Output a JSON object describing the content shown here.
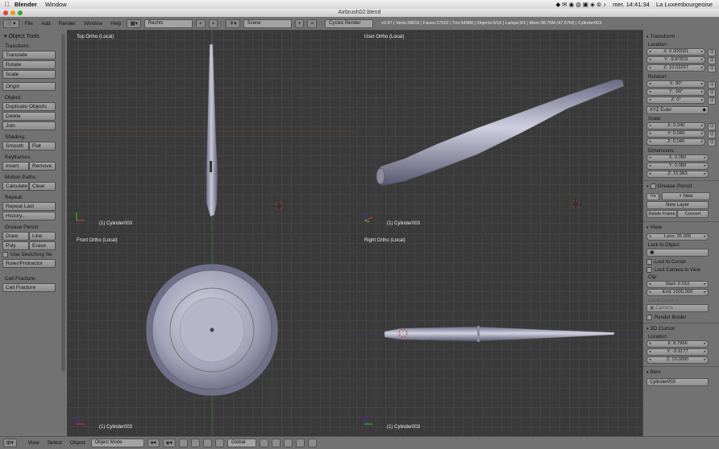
{
  "menubar": {
    "app": "Blender",
    "window_menu": "Window",
    "clock": "mer. 14:41:34",
    "user": "La Luxembourgeoise"
  },
  "titlebar": {
    "title": "Airbrush02.blend"
  },
  "infobar": {
    "menus": [
      "File",
      "Add",
      "Render",
      "Window",
      "Help"
    ],
    "layout": "Rechts",
    "scene": "Scene",
    "engine": "Cycles Render",
    "stats": "v2.67 | Verts:28616 | Faces:27522 | Tris:54988 | Objects:0/16 | Lamps:0/1 | Mem:38.70M (47.57M) | Cylinder003"
  },
  "toolshelf": {
    "title": "Object Tools",
    "transform_label": "Transform:",
    "translate": "Translate",
    "rotate": "Rotate",
    "scale": "Scale",
    "origin": "Origin",
    "object_label": "Object:",
    "duplicate": "Duplicate Objects",
    "delete": "Delete",
    "join": "Join",
    "shading_label": "Shading:",
    "smooth": "Smooth",
    "flat": "Flat",
    "keyframes_label": "Keyframes:",
    "insert": "Insert",
    "remove": "Remove",
    "motion_label": "Motion Paths:",
    "calculate": "Calculate",
    "clear": "Clear",
    "repeat_label": "Repeat:",
    "repeat_last": "Repeat Last",
    "history": "History...",
    "grease_label": "Grease Pencil:",
    "draw": "Draw",
    "line": "Line",
    "poly": "Poly",
    "erase": "Erase",
    "sketching": "Use Sketching Se",
    "ruler": "Ruler/Protractor",
    "cell_label": "Cell Fracture:",
    "cell_btn": "Cell Fracture"
  },
  "viewport": {
    "top_left": "Top Ortho (Local)",
    "top_right": "User Ortho (Local)",
    "bottom_left": "Front Ortho (Local)",
    "bottom_right": "Right Ortho (Local)",
    "object": "(1) Cylinder003"
  },
  "props": {
    "transform_title": "Transform",
    "location_label": "Location:",
    "loc_x": "X: 0.000001",
    "loc_y": "Y: -9.87815",
    "loc_z": "Z: 10.03257",
    "rotation_label": "Rotation:",
    "rot_x": "X: 90°",
    "rot_y": "Y: -90°",
    "rot_z": "Z: 0°",
    "euler": "XYZ Euler",
    "scale_label": "Scale:",
    "scale_x": "X: 0.040",
    "scale_y": "Y: 0.040",
    "scale_z": "Z: 0.040",
    "dim_label": "Dimensions:",
    "dim_x": "X: 0.080",
    "dim_y": "Y: 0.080",
    "dim_z": "Z: 15.983",
    "grease_title": "Grease Pencil",
    "new_btn": "New",
    "new_layer": "New Layer",
    "delete_frame": "Delete Frame",
    "convert": "Convert",
    "view_title": "View",
    "lens": "Lens: 35.000",
    "lock_obj_label": "Lock to Object:",
    "lock_cursor": "Lock to Cursor",
    "lock_camera": "Lock Camera to View",
    "clip_label": "Clip:",
    "clip_start": "Start: 0.010",
    "clip_end": "End: 1000.000",
    "local_camera_label": "Local Camera:",
    "camera": "Camera",
    "render_border": "Render Border",
    "cursor_title": "3D Cursor",
    "cursor_loc_label": "Location:",
    "cur_x": "X: 8.7866",
    "cur_y": "Y: -9.9177",
    "cur_z": "Z: 10.0000",
    "item_title": "Item",
    "item_name": "Cylinder003"
  },
  "bottombar": {
    "view": "View",
    "select": "Select",
    "object": "Object",
    "mode": "Object Mode",
    "orientation": "Global"
  }
}
